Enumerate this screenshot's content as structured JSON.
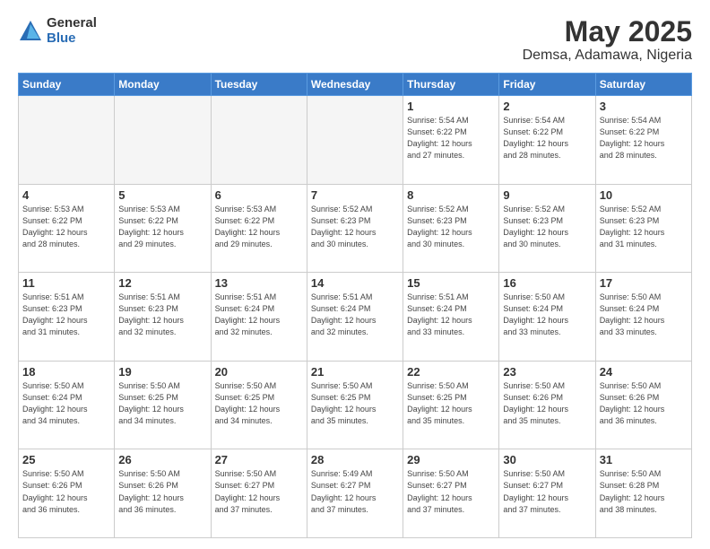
{
  "header": {
    "logo_general": "General",
    "logo_blue": "Blue",
    "main_title": "May 2025",
    "subtitle": "Demsa, Adamawa, Nigeria"
  },
  "weekdays": [
    "Sunday",
    "Monday",
    "Tuesday",
    "Wednesday",
    "Thursday",
    "Friday",
    "Saturday"
  ],
  "weeks": [
    [
      {
        "day": "",
        "info": ""
      },
      {
        "day": "",
        "info": ""
      },
      {
        "day": "",
        "info": ""
      },
      {
        "day": "",
        "info": ""
      },
      {
        "day": "1",
        "info": "Sunrise: 5:54 AM\nSunset: 6:22 PM\nDaylight: 12 hours\nand 27 minutes."
      },
      {
        "day": "2",
        "info": "Sunrise: 5:54 AM\nSunset: 6:22 PM\nDaylight: 12 hours\nand 28 minutes."
      },
      {
        "day": "3",
        "info": "Sunrise: 5:54 AM\nSunset: 6:22 PM\nDaylight: 12 hours\nand 28 minutes."
      }
    ],
    [
      {
        "day": "4",
        "info": "Sunrise: 5:53 AM\nSunset: 6:22 PM\nDaylight: 12 hours\nand 28 minutes."
      },
      {
        "day": "5",
        "info": "Sunrise: 5:53 AM\nSunset: 6:22 PM\nDaylight: 12 hours\nand 29 minutes."
      },
      {
        "day": "6",
        "info": "Sunrise: 5:53 AM\nSunset: 6:22 PM\nDaylight: 12 hours\nand 29 minutes."
      },
      {
        "day": "7",
        "info": "Sunrise: 5:52 AM\nSunset: 6:23 PM\nDaylight: 12 hours\nand 30 minutes."
      },
      {
        "day": "8",
        "info": "Sunrise: 5:52 AM\nSunset: 6:23 PM\nDaylight: 12 hours\nand 30 minutes."
      },
      {
        "day": "9",
        "info": "Sunrise: 5:52 AM\nSunset: 6:23 PM\nDaylight: 12 hours\nand 30 minutes."
      },
      {
        "day": "10",
        "info": "Sunrise: 5:52 AM\nSunset: 6:23 PM\nDaylight: 12 hours\nand 31 minutes."
      }
    ],
    [
      {
        "day": "11",
        "info": "Sunrise: 5:51 AM\nSunset: 6:23 PM\nDaylight: 12 hours\nand 31 minutes."
      },
      {
        "day": "12",
        "info": "Sunrise: 5:51 AM\nSunset: 6:23 PM\nDaylight: 12 hours\nand 32 minutes."
      },
      {
        "day": "13",
        "info": "Sunrise: 5:51 AM\nSunset: 6:24 PM\nDaylight: 12 hours\nand 32 minutes."
      },
      {
        "day": "14",
        "info": "Sunrise: 5:51 AM\nSunset: 6:24 PM\nDaylight: 12 hours\nand 32 minutes."
      },
      {
        "day": "15",
        "info": "Sunrise: 5:51 AM\nSunset: 6:24 PM\nDaylight: 12 hours\nand 33 minutes."
      },
      {
        "day": "16",
        "info": "Sunrise: 5:50 AM\nSunset: 6:24 PM\nDaylight: 12 hours\nand 33 minutes."
      },
      {
        "day": "17",
        "info": "Sunrise: 5:50 AM\nSunset: 6:24 PM\nDaylight: 12 hours\nand 33 minutes."
      }
    ],
    [
      {
        "day": "18",
        "info": "Sunrise: 5:50 AM\nSunset: 6:24 PM\nDaylight: 12 hours\nand 34 minutes."
      },
      {
        "day": "19",
        "info": "Sunrise: 5:50 AM\nSunset: 6:25 PM\nDaylight: 12 hours\nand 34 minutes."
      },
      {
        "day": "20",
        "info": "Sunrise: 5:50 AM\nSunset: 6:25 PM\nDaylight: 12 hours\nand 34 minutes."
      },
      {
        "day": "21",
        "info": "Sunrise: 5:50 AM\nSunset: 6:25 PM\nDaylight: 12 hours\nand 35 minutes."
      },
      {
        "day": "22",
        "info": "Sunrise: 5:50 AM\nSunset: 6:25 PM\nDaylight: 12 hours\nand 35 minutes."
      },
      {
        "day": "23",
        "info": "Sunrise: 5:50 AM\nSunset: 6:26 PM\nDaylight: 12 hours\nand 35 minutes."
      },
      {
        "day": "24",
        "info": "Sunrise: 5:50 AM\nSunset: 6:26 PM\nDaylight: 12 hours\nand 36 minutes."
      }
    ],
    [
      {
        "day": "25",
        "info": "Sunrise: 5:50 AM\nSunset: 6:26 PM\nDaylight: 12 hours\nand 36 minutes."
      },
      {
        "day": "26",
        "info": "Sunrise: 5:50 AM\nSunset: 6:26 PM\nDaylight: 12 hours\nand 36 minutes."
      },
      {
        "day": "27",
        "info": "Sunrise: 5:50 AM\nSunset: 6:27 PM\nDaylight: 12 hours\nand 37 minutes."
      },
      {
        "day": "28",
        "info": "Sunrise: 5:49 AM\nSunset: 6:27 PM\nDaylight: 12 hours\nand 37 minutes."
      },
      {
        "day": "29",
        "info": "Sunrise: 5:50 AM\nSunset: 6:27 PM\nDaylight: 12 hours\nand 37 minutes."
      },
      {
        "day": "30",
        "info": "Sunrise: 5:50 AM\nSunset: 6:27 PM\nDaylight: 12 hours\nand 37 minutes."
      },
      {
        "day": "31",
        "info": "Sunrise: 5:50 AM\nSunset: 6:28 PM\nDaylight: 12 hours\nand 38 minutes."
      }
    ]
  ]
}
